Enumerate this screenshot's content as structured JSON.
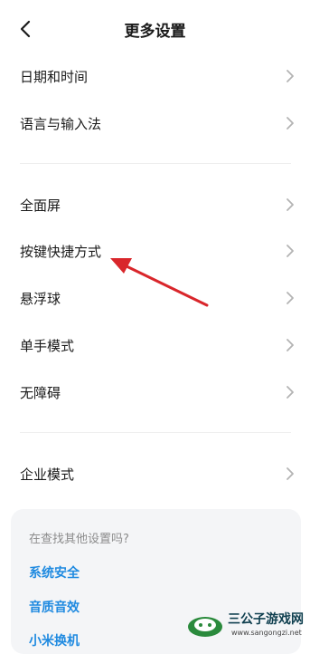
{
  "header": {
    "title": "更多设置",
    "back_icon": "chevron-left-icon"
  },
  "groups": [
    {
      "items": [
        {
          "label": "日期和时间"
        },
        {
          "label": "语言与输入法"
        }
      ]
    },
    {
      "items": [
        {
          "label": "全面屏"
        },
        {
          "label": "按键快捷方式"
        },
        {
          "label": "悬浮球"
        },
        {
          "label": "单手模式"
        },
        {
          "label": "无障碍"
        }
      ]
    },
    {
      "items": [
        {
          "label": "企业模式"
        }
      ]
    }
  ],
  "suggestion_card": {
    "hint": "在查找其他设置吗?",
    "links": [
      "系统安全",
      "音质音效",
      "小米换机"
    ]
  },
  "annotation": {
    "color": "#d9262b",
    "points_to": "按键快捷方式"
  },
  "watermark": {
    "name": "三公子游戏网",
    "url": "www.sangongzi.net"
  },
  "colors": {
    "accent_link": "#1f8ae0",
    "chevron": "#b3b3b3"
  }
}
